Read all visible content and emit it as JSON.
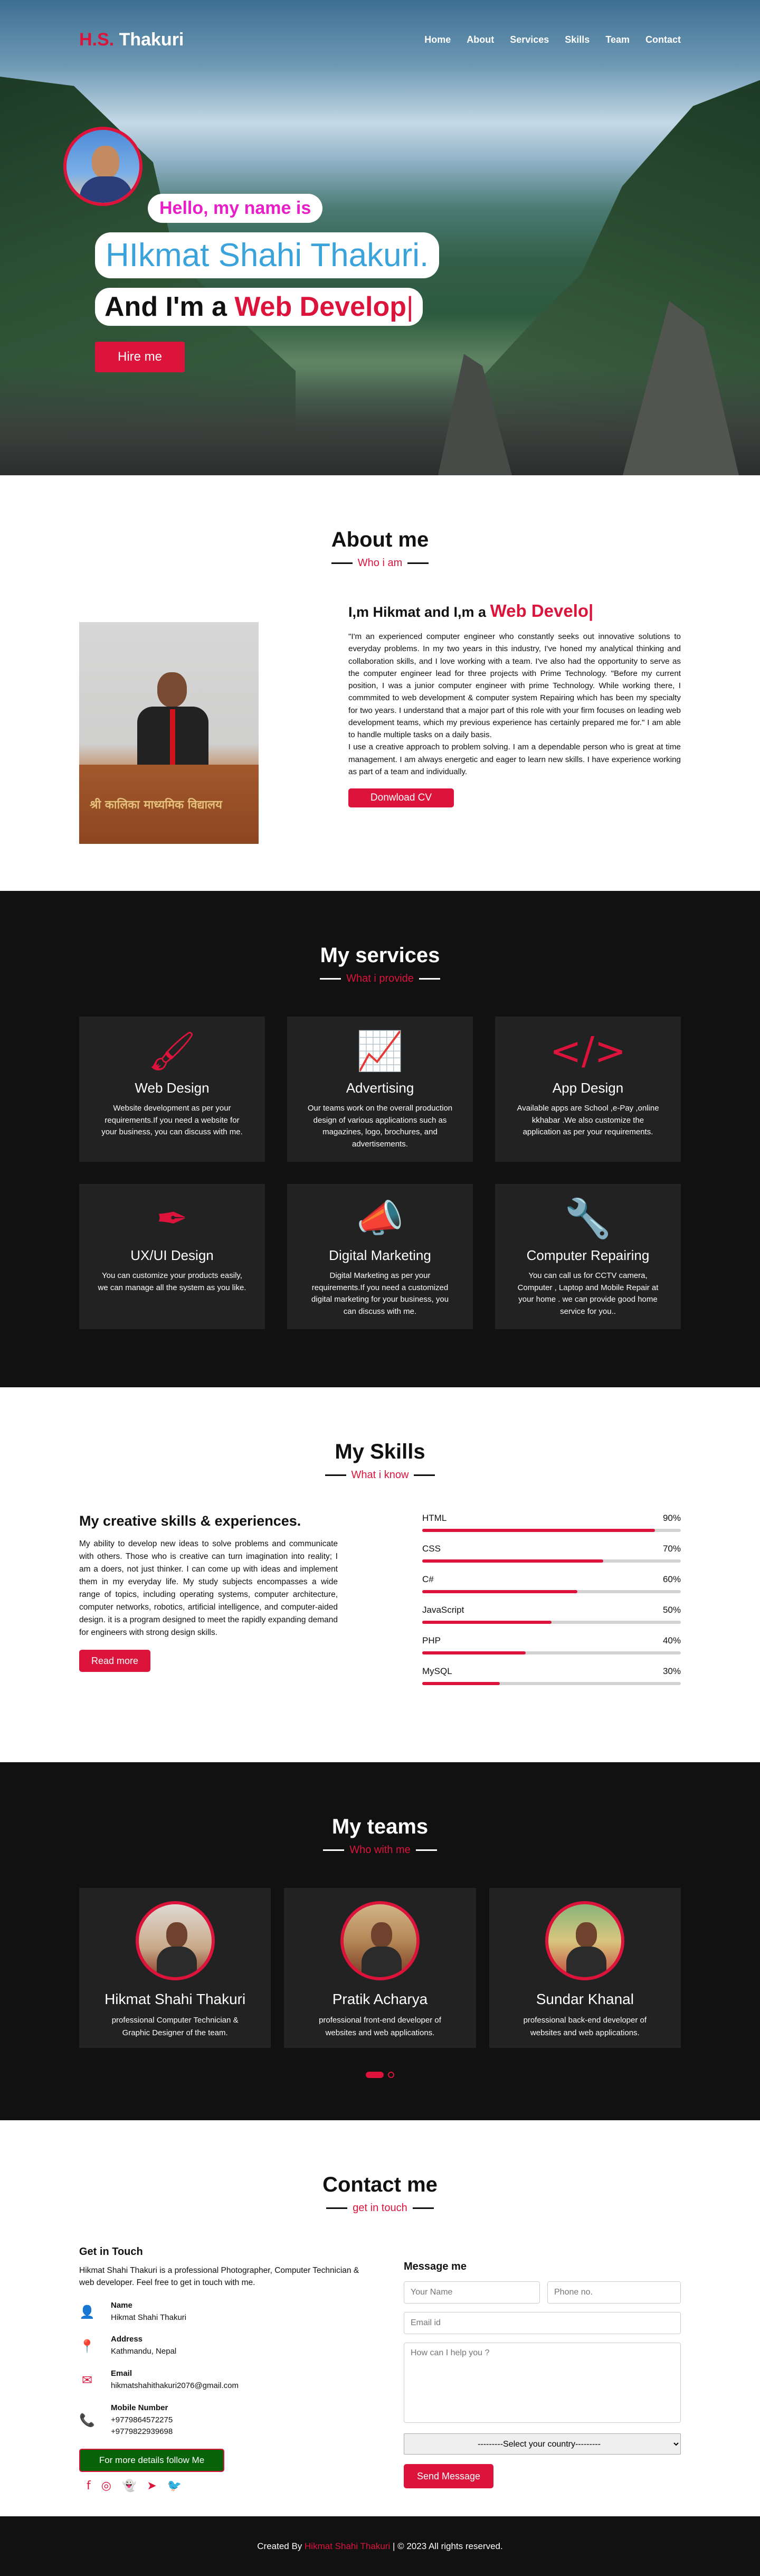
{
  "brand": {
    "initials": "H.S.",
    "surname": "Thakuri"
  },
  "nav": [
    "Home",
    "About",
    "Services",
    "Skills",
    "Team",
    "Contact"
  ],
  "hero": {
    "greeting": "Hello, my name is",
    "name": "HIkmat Shahi Thakuri.",
    "role_prefix": "And I'm a",
    "role_typed": "Web Develop",
    "cursor": "|",
    "button": "Hire me"
  },
  "about": {
    "title": "About me",
    "subtitle": "Who i am",
    "heading_prefix": "I,m Hikmat and I,m a",
    "heading_typed": "Web Develo",
    "cursor": "|",
    "photo_caption": "श्री कालिका माध्यमिक विद्यालय",
    "paragraph": "\"I'm an experienced computer engineer who constantly seeks out innovative solutions to everyday problems. In my two years in this industry, I've honed my analytical thinking and collaboration skills, and I love working with a team. I've also had the opportunity to serve as the computer engineer lead for three projects with Prime Technology. \"Before my current position, I was a junior computer engineer with prime Technology. While working there, I commmited to web development & computer system Repairing which has been my specialty for two years. I understand that a major part of this role with your firm focuses on leading web development teams, which my previous experience has certainly prepared me for.\" I am able to handle multiple tasks on a daily basis.",
    "paragraph2": "I use a creative approach to problem solving. I am a dependable person who is great at time management. I am always energetic and eager to learn new skills. I have experience working as part of a team and individually.",
    "button": "Donwload CV"
  },
  "services": {
    "title": "My services",
    "subtitle": "What i provide",
    "cards": [
      {
        "icon": "paintbrush-icon",
        "glyph": "🖌",
        "title": "Web Design",
        "text": "Website development as per your requirements.If you need a website for your business, you can discuss with me."
      },
      {
        "icon": "chart-line-icon",
        "glyph": "📈",
        "title": "Advertising",
        "text": "Our teams work on the overall production design of various applications such as magazines, logo, brochures, and advertisements."
      },
      {
        "icon": "code-icon",
        "glyph": "</>",
        "title": "App Design",
        "text": "Available apps are School ,e-Pay ,online kkhabar .We also customize the application as per your requirements."
      },
      {
        "icon": "pen-ruler-icon",
        "glyph": "✒",
        "title": "UX/UI Design",
        "text": "You can customize your products easily, we can manage all the system as you like."
      },
      {
        "icon": "bullhorn-icon",
        "glyph": "📣",
        "title": "Digital Marketing",
        "text": "Digital Marketing as per your requirements.If you need a customized digital marketing for your business, you can discuss with me."
      },
      {
        "icon": "wrench-icon",
        "glyph": "🔧",
        "title": "Computer Repairing",
        "text": "You can call us for CCTV camera, Computer , Laptop and Mobile Repair at your home . we can provide good home service for you.."
      }
    ]
  },
  "skills": {
    "title": "My Skills",
    "subtitle": "What i know",
    "heading": "My creative skills & experiences.",
    "paragraph": "My ability to develop new ideas to solve problems and communicate with others. Those who is creative can turn imagination into reality; I am a doers, not just thinker. I can come up with ideas and implement them in my everyday life. My study subjects encompasses a wide range of topics, including operating systems, computer architecture, computer networks, robotics, artificial intelligence, and computer-aided design. it is a program designed to meet the rapidly expanding demand for engineers with strong design skills.",
    "button": "Read more",
    "bars": [
      {
        "name": "HTML",
        "percent_label": "90%",
        "percent": 90
      },
      {
        "name": "CSS",
        "percent_label": "70%",
        "percent": 70
      },
      {
        "name": "C#",
        "percent_label": "60%",
        "percent": 60
      },
      {
        "name": "JavaScript",
        "percent_label": "50%",
        "percent": 50
      },
      {
        "name": "PHP",
        "percent_label": "40%",
        "percent": 40
      },
      {
        "name": "MySQL",
        "percent_label": "30%",
        "percent": 30
      }
    ]
  },
  "teams": {
    "title": "My teams",
    "subtitle": "Who with me",
    "members": [
      {
        "name": "Hikmat Shahi Thakuri",
        "role": "professional Computer Technician & Graphic Designer of the team."
      },
      {
        "name": "Pratik Acharya",
        "role": "professional front-end developer of websites and web applications."
      },
      {
        "name": "Sundar Khanal",
        "role": "professional back-end developer of websites and web applications."
      }
    ]
  },
  "contact": {
    "title": "Contact me",
    "subtitle": "get in touch",
    "heading": "Get in Touch",
    "intro": "Hikmat Shahi Thakuri is a professional Photographer, Computer Technician & web developer. Feel free to get in touch with me.",
    "info": [
      {
        "icon": "user-icon",
        "glyph": "👤",
        "label": "Name",
        "value": "Hikmat Shahi Thakuri"
      },
      {
        "icon": "map-marker-icon",
        "glyph": "📍",
        "label": "Address",
        "value": "Kathmandu, Nepal"
      },
      {
        "icon": "envelope-icon",
        "glyph": "✉",
        "label": "Email",
        "value": "hikmatshahithakuri2076@gmail.com"
      },
      {
        "icon": "phone-icon",
        "glyph": "📞",
        "label": "Mobile Number",
        "value": "+9779864572275",
        "value2": "+9779822939698"
      }
    ],
    "follow_button": "For more details follow Me",
    "social": [
      {
        "icon": "facebook-icon",
        "glyph": "f"
      },
      {
        "icon": "instagram-icon",
        "glyph": "◎"
      },
      {
        "icon": "snapchat-icon",
        "glyph": "👻"
      },
      {
        "icon": "telegram-icon",
        "glyph": "➤"
      },
      {
        "icon": "twitter-icon",
        "glyph": "🐦"
      }
    ],
    "form": {
      "heading": "Message me",
      "name_placeholder": "Your Name",
      "phone_placeholder": "Phone no.",
      "email_placeholder": "Email id",
      "message_placeholder": "How can I help you ?",
      "country_selected": "---------Select your country---------",
      "send_button": "Send Message"
    }
  },
  "footer": {
    "prefix": "Created By",
    "name": "Hikmat Shahi Thakuri",
    "suffix": "| © 2023 All rights reserved."
  }
}
